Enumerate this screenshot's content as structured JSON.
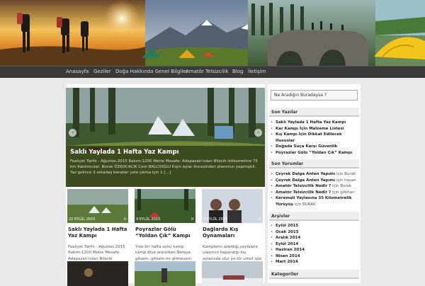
{
  "nav": {
    "items": [
      "Anasayfa",
      "Geziler",
      "Doğa Hakkında Genel Bilgiler",
      "Amatör Telsizcilik",
      "Blog",
      "İletişim"
    ]
  },
  "slider": {
    "title": "Saklı Yaylada 1 Hafta Yaz Kampı",
    "text": "Faaliyet Tarihi : Ağustos.2015 Rakım:1200 Metre Mesafe: Adapazarı'ndan Bilecik istikametine 75 km Katılımcılar: Burak ÖZKOCACIK Cem BALCIOĞLU Kışın aylar öncesinden planımızı yapmıştık. Yaz gelince 3 arkadaş beraber yola çıkma için 1 [...]"
  },
  "cards": [
    {
      "date": "22 EYLÜL 2015",
      "comments": "0",
      "title": "Saklı Yaylada 1 Hafta Yaz Kampı",
      "excerpt": "Faaliyet Tarihi : Ağustos.2015 Rakım:1200 Metre Mesafe: Adapazarı'ndan Bilecik"
    },
    {
      "date": "9 EYLÜL 2015",
      "comments": "0",
      "title": "Poyrazlar Gölü “Yoldan Çık” Kampı",
      "excerpt": "Yine bir hafta sonu kamp kamp diye aranırken,Nereye gitsem ,gitsem mi gitmesem mi diye"
    },
    {
      "date": "9 EYLÜL 2015",
      "comments": "0",
      "title": "Dağlarda Kış Oynamaları",
      "excerpt": "Kampların azaldığı,yaylalara ulaşımın kapandığı kış aylarında olur ya bir umut işte belki"
    }
  ],
  "sidebar": {
    "search_placeholder": "Ne Aradığın Buradaysa ?",
    "recent_posts_title": "Son Yazılar",
    "recent_posts": [
      "Saklı Yaylada 1 Hafta Yaz Kampı",
      "Kar Kampı İçin Malzeme Listesi",
      "Kış Kampı İçin Dikkat Edilecek Hususlar",
      "Doğada Suça Karşı Güvenlik",
      "Poyrazlar Gölü “Yoldan Çık” Kampı"
    ],
    "recent_comments_title": "Son Yorumlar",
    "recent_comments": [
      {
        "title": "Çeyrek Dalga Anten Yapımı",
        "sep": " için ",
        "author": "Burak"
      },
      {
        "title": "Çeyrek Dalga Anten Yapımı",
        "sep": " için ",
        "author": "hasan"
      },
      {
        "title": "Amatör Telsizcilik Nedir ?",
        "sep": " için ",
        "author": "Burak"
      },
      {
        "title": "Amatör Telsizcilik Nedir ?",
        "sep": " için ",
        "author": "gökhan"
      },
      {
        "title": "Keremali Yaylasına 35 Kilometrelik Yürüyüş",
        "sep": " için ",
        "author": "BURAK"
      }
    ],
    "archives_title": "Arşivler",
    "archives": [
      "Eylül 2015",
      "Ocak 2015",
      "Aralık 2014",
      "Eylül 2014",
      "Haziran 2014",
      "Nisan 2014",
      "Mart 2014"
    ],
    "categories_title": "Kategoriler"
  }
}
